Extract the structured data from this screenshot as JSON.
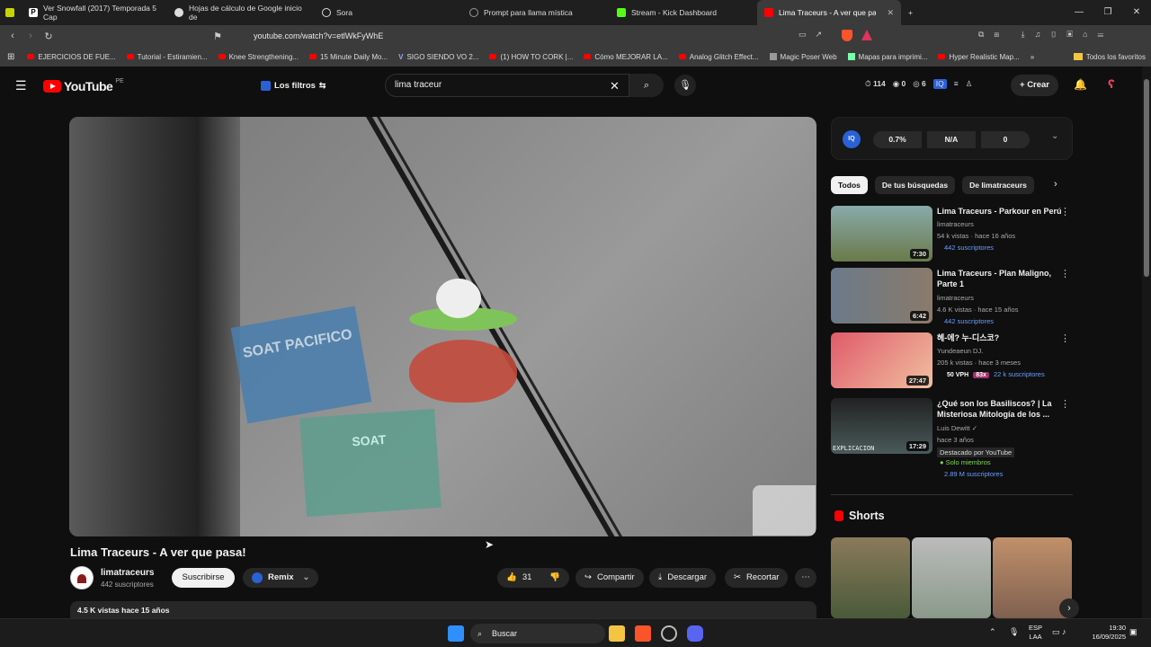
{
  "browser": {
    "tabs": [
      {
        "label": "Ver Snowfall (2017) Temporada 5 Cap",
        "color": "#ffffff",
        "active": false
      },
      {
        "label": "Hojas de cálculo de Google inicio de",
        "color": "#34a853",
        "active": false
      },
      {
        "label": "Sora",
        "color": "#dddddd",
        "active": false
      },
      {
        "label": "Prompt para llama mística",
        "color": "#999999",
        "active": false
      },
      {
        "label": "Stream - Kick Dashboard",
        "color": "#53fc18",
        "active": false
      },
      {
        "label": "Lima Traceurs - A ver que pasa",
        "color": "#ff0000",
        "active": true
      }
    ],
    "url": "youtube.com/watch?v=etlWkFyWhE",
    "bookmarks": [
      "EJERCICIOS DE FUE...",
      "Tutorial - Estiramien...",
      "Knee Strengthening...",
      "15 Minute Daily Mo...",
      "SIGO SIENDO VO 2...",
      "(1) HOW TO CORK |...",
      "Cómo MEJORAR LA...",
      "Analog Glitch Effect...",
      "Magic Poser Web",
      "Mapas para imprimi...",
      "Hyper Realistic Map..."
    ],
    "bookmarks_folder": "Todos los favoritos"
  },
  "header": {
    "logo_text": "YouTube",
    "logo_region": "PE",
    "filters_label": "Los filtros",
    "search_value": "lima traceur",
    "stats": [
      "114",
      "0",
      "6"
    ],
    "create_label": "Crear"
  },
  "video": {
    "title": "Lima Traceurs - A ver que pasa!",
    "sticker_top": "SOAT PACIFICO",
    "sticker_bottom": "SOAT",
    "channel_name": "limatraceurs",
    "channel_subs": "442 suscriptores",
    "subscribe_label": "Suscribirse",
    "remix_label": "Remix",
    "likes": "31",
    "share_label": "Compartir",
    "download_label": "Descargar",
    "clip_label": "Recortar",
    "description_meta": "4.5 K vistas  hace 15 años"
  },
  "iq_panel": {
    "badge": "IQ",
    "metrics": [
      "0.7%",
      "N/A",
      "0"
    ]
  },
  "chips": [
    {
      "label": "Todos",
      "selected": true
    },
    {
      "label": "De tus búsquedas",
      "selected": false
    },
    {
      "label": "De limatraceurs",
      "selected": false
    }
  ],
  "recommendations": [
    {
      "title": "Lima Traceurs - Parkour en Perú",
      "channel": "limatraceurs",
      "meta": "54 k vistas · hace 16 años",
      "extra": "442 suscriptores",
      "duration": "7:30",
      "thumb_color": "#5a6b3a"
    },
    {
      "title": "Lima Traceurs - Plan Maligno, Parte 1",
      "channel": "limatraceurs",
      "meta": "4.6 K vistas · hace 15 años",
      "extra": "442 suscriptores",
      "duration": "6:42",
      "thumb_color": "#6b7a8a"
    },
    {
      "title": "헤-에? 누-디스코?",
      "channel": "Yundeaeun DJ.",
      "meta": "205 k vistas · hace 3 meses",
      "tag1": "50 VPH",
      "tag2": "83x",
      "extra": "22 k suscriptores",
      "duration": "27:47",
      "thumb_color": "#c85a6a"
    },
    {
      "title": "¿Qué son los Basiliscos? | La Misteriosa Mitología de los ...",
      "channel": "Luis Dewitt",
      "meta": "hace 3 años",
      "line4": "Destacado por YouTube",
      "line5": "Solo miembros",
      "extra": "2.89 M suscriptores",
      "duration": "17:29",
      "thumb_caption": "EXPLICACION",
      "thumb_color": "#3a4a4a"
    }
  ],
  "shorts": {
    "heading": "Shorts",
    "thumbs": [
      "#7a6b4a",
      "#9aa0a0",
      "#a0785a"
    ]
  },
  "taskbar": {
    "search_label": "Buscar",
    "lang": "ESP",
    "lang2": "LAA",
    "time": "19:30",
    "date": "16/09/2025"
  }
}
